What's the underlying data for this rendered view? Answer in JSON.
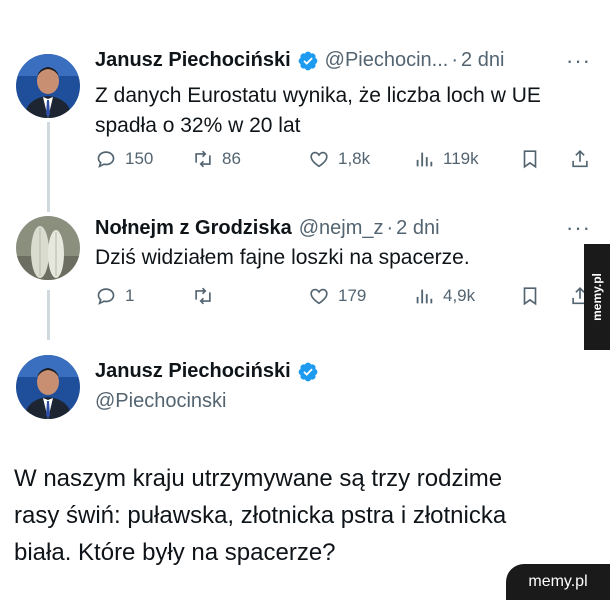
{
  "tweet1": {
    "name": "Janusz Piechociński",
    "handle": "@Piechocin...",
    "dot": "·",
    "time": "2 dni",
    "more": "···",
    "text": "Z danych Eurostatu wynika, że liczba loch w UE spadła o 32% w 20 lat",
    "stats": {
      "replies": "150",
      "retweets": "86",
      "likes": "1,8k",
      "views": "119k"
    }
  },
  "tweet2": {
    "name": "Nołnejm z Grodziska",
    "handle": "@nejm_z",
    "dot": "·",
    "time": "2 dni",
    "more": "···",
    "text": "Dziś widziałem fajne loszki na spacerze.",
    "stats": {
      "replies": "1",
      "retweets": "",
      "likes": "179",
      "views": "4,9k"
    }
  },
  "tweet3": {
    "name": "Janusz Piechociński",
    "handle": "@Piechocinski",
    "text_lines": [
      "W naszym kraju utrzymywane są trzy rodzime",
      "rasy świń: puławska, złotnicka pstra i złotnicka",
      "biała. Które były na spacerze?"
    ]
  },
  "watermarks": {
    "side": "memy.pl",
    "bottom": "memy.pl"
  },
  "colors": {
    "verified": "#1d9bf0",
    "muted": "#536471",
    "thread_line": "#cfd9de",
    "text": "#0f1419"
  },
  "icons": [
    "reply-icon",
    "retweet-icon",
    "like-icon",
    "views-icon",
    "bookmark-icon",
    "share-icon",
    "verified-badge-icon"
  ]
}
